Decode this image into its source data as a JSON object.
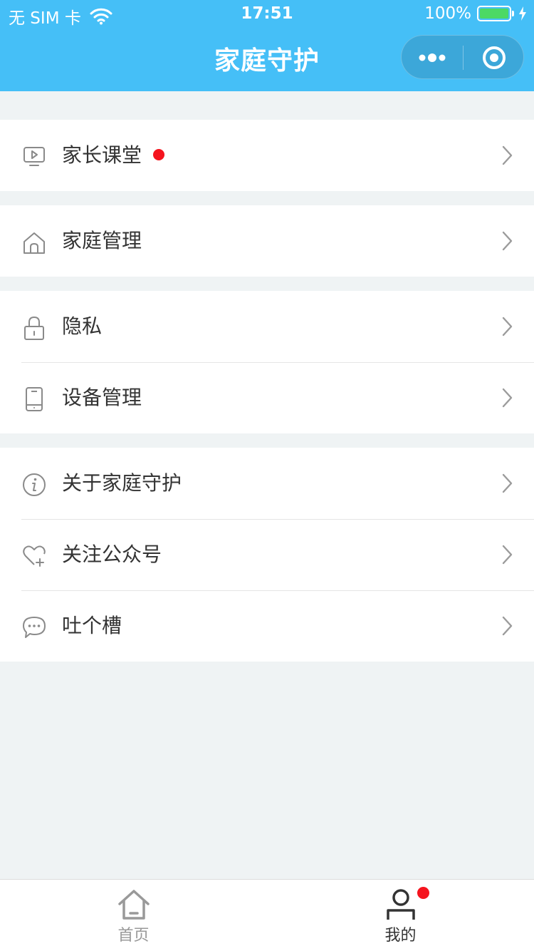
{
  "status_bar": {
    "carrier": "无 SIM 卡",
    "time": "17:51",
    "battery": "100%",
    "battery_color": "#4cd964"
  },
  "header": {
    "title": "家庭守护",
    "background": "#45bff7",
    "more_icon": "more-dots-icon",
    "close_icon": "target-circle-icon"
  },
  "menu": {
    "groups": [
      {
        "items": [
          {
            "label": "家长课堂",
            "icon": "video-play-icon",
            "badge": "red-dot"
          }
        ]
      },
      {
        "items": [
          {
            "label": "家庭管理",
            "icon": "home-icon"
          }
        ]
      },
      {
        "items": [
          {
            "label": "隐私",
            "icon": "lock-icon"
          },
          {
            "label": "设备管理",
            "icon": "phone-device-icon"
          }
        ]
      },
      {
        "items": [
          {
            "label": "关于家庭守护",
            "icon": "info-icon"
          },
          {
            "label": "关注公众号",
            "icon": "heart-plus-icon"
          },
          {
            "label": "吐个槽",
            "icon": "chat-bubble-icon"
          }
        ]
      }
    ],
    "chevron_icon": "chevron-right-icon"
  },
  "tab_bar": {
    "tabs": [
      {
        "label": "首页",
        "icon": "home-tab-icon",
        "active": false
      },
      {
        "label": "我的",
        "icon": "user-tab-icon",
        "active": true,
        "badge": "red-dot"
      }
    ],
    "badge_color": "#f5141e"
  }
}
